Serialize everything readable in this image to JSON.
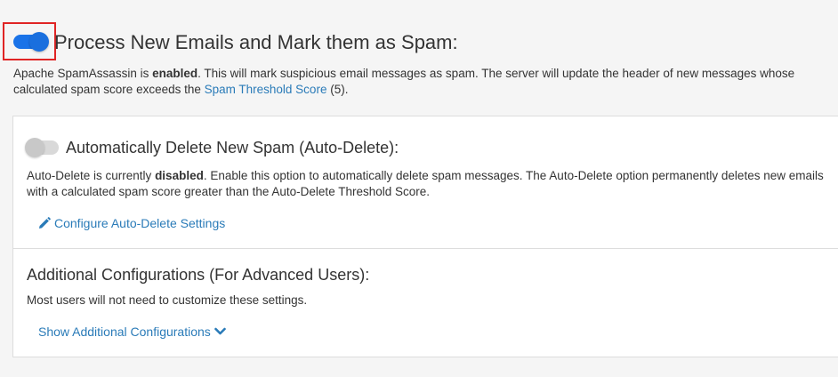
{
  "main": {
    "title": "Process New Emails and Mark them as Spam:",
    "toggle_state": "on",
    "description": {
      "part1": "Apache SpamAssassin is ",
      "status": "enabled",
      "part2": ". This will mark suspicious email messages as spam. The server will update the header of new messages whose calculated spam score exceeds the ",
      "link": "Spam Threshold Score",
      "part3": " (5)."
    }
  },
  "auto_delete": {
    "title": "Automatically Delete New Spam (Auto-Delete):",
    "toggle_state": "off",
    "description": {
      "part1": "Auto-Delete is currently ",
      "status": "disabled",
      "part2": ". Enable this option to automatically delete spam messages. The Auto-Delete option permanently deletes new emails with a calculated spam score greater than the Auto-Delete Threshold Score."
    },
    "configure_link": "Configure Auto-Delete Settings",
    "configure_icon": "pencil-icon"
  },
  "additional": {
    "title": "Additional Configurations (For Advanced Users):",
    "description": "Most users will not need to customize these settings.",
    "show_link": "Show Additional Configurations",
    "show_icon": "chevron-down-icon"
  },
  "colors": {
    "accent": "#1a73e8",
    "link": "#2a7bb8",
    "highlight": "#e02424",
    "toggle_off": "#d9d9d9"
  }
}
